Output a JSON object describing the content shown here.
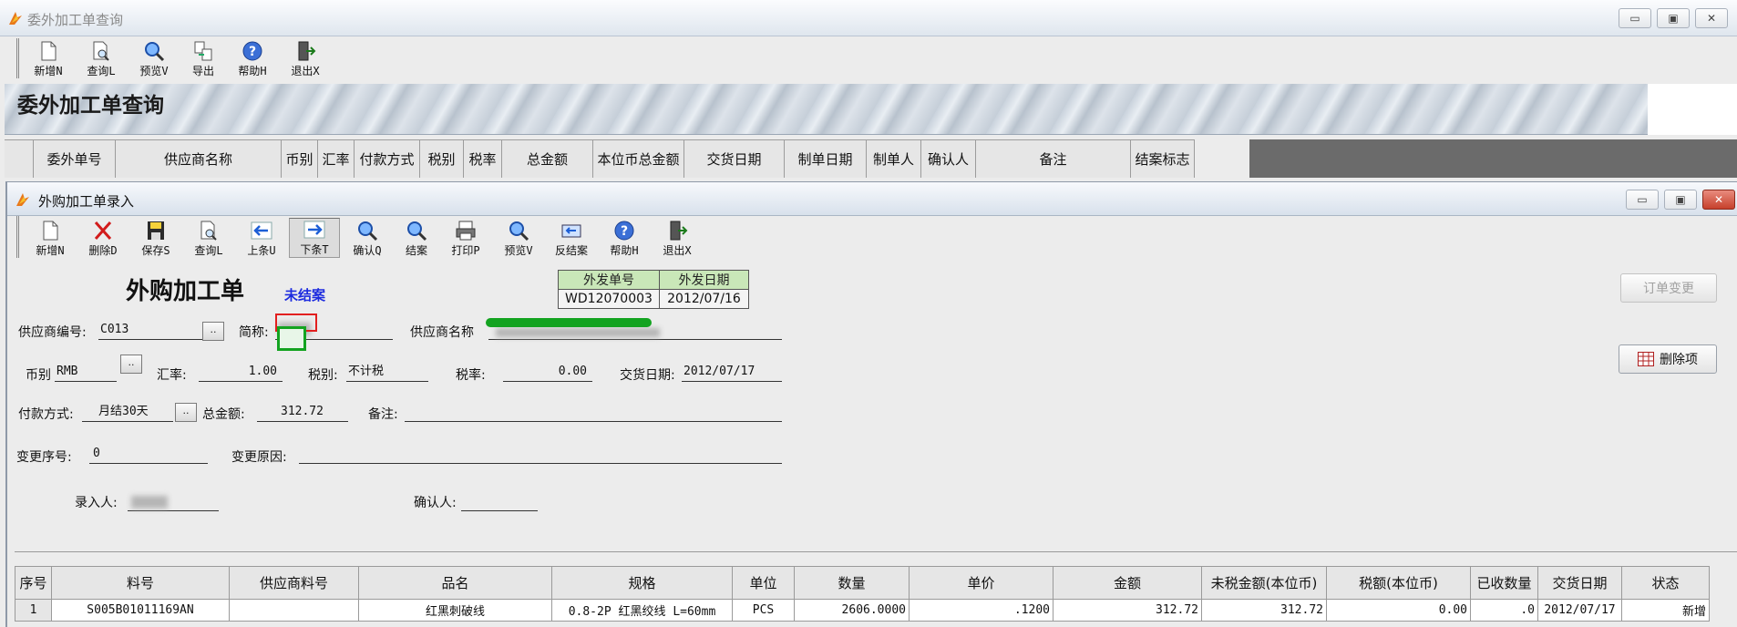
{
  "outer_window": {
    "title": "委外加工单查询",
    "buttons": {
      "minimize": "▭",
      "maximize": "▣",
      "close": "✕"
    }
  },
  "outer_toolbar": [
    {
      "label": "新增N",
      "icon": "new-doc-icon"
    },
    {
      "label": "查询L",
      "icon": "query-doc-icon"
    },
    {
      "label": "预览V",
      "icon": "preview-magnifier-icon"
    },
    {
      "label": "导出",
      "icon": "export-icon"
    },
    {
      "label": "帮助H",
      "icon": "help-icon"
    },
    {
      "label": "退出X",
      "icon": "exit-door-icon"
    }
  ],
  "banner_title": "委外加工单查询",
  "outer_grid_columns": [
    "委外单号",
    "供应商名称",
    "币别",
    "汇率",
    "付款方式",
    "税别",
    "税率",
    "总金额",
    "本位币总金额",
    "交货日期",
    "制单日期",
    "制单人",
    "确认人",
    "备注",
    "结案标志"
  ],
  "inner_window": {
    "title": "外购加工单录入",
    "buttons": {
      "minimize": "▭",
      "maximize": "▣",
      "close": "✕"
    }
  },
  "inner_toolbar": [
    {
      "label": "新增N",
      "icon": "new-doc-icon"
    },
    {
      "label": "删除D",
      "icon": "delete-x-icon"
    },
    {
      "label": "保存S",
      "icon": "save-disk-icon"
    },
    {
      "label": "查询L",
      "icon": "query-doc-icon"
    },
    {
      "label": "上条U",
      "icon": "arrow-left-icon"
    },
    {
      "label": "下条T",
      "icon": "arrow-right-icon"
    },
    {
      "label": "确认Q",
      "icon": "confirm-magnifier-icon"
    },
    {
      "label": "结案",
      "icon": "close-case-magnifier-icon"
    },
    {
      "label": "打印P",
      "icon": "printer-icon"
    },
    {
      "label": "预览V",
      "icon": "preview-magnifier-icon"
    },
    {
      "label": "反结案",
      "icon": "reverse-close-icon"
    },
    {
      "label": "帮助H",
      "icon": "help-icon"
    },
    {
      "label": "退出X",
      "icon": "exit-door-icon"
    }
  ],
  "form": {
    "title": "外购加工单",
    "status": "未结案",
    "info_headers": [
      "外发单号",
      "外发日期"
    ],
    "info_values": [
      "WD12070003",
      "2012/07/16"
    ],
    "supplier_code_label": "供应商编号:",
    "supplier_code": "C013",
    "short_name_label": "简称:",
    "supplier_name_label": "供应商名称",
    "currency_label": "币别",
    "currency": "RMB",
    "rate_label": "汇率:",
    "rate": "1.00",
    "tax_type_label": "税别:",
    "tax_type": "不计税",
    "tax_rate_label": "税率:",
    "tax_rate": "0.00",
    "delivery_label": "交货日期:",
    "delivery": "2012/07/17",
    "payment_label": "付款方式:",
    "payment": "月结30天",
    "total_label": "总金额:",
    "total": "312.72",
    "remark_label": "备注:",
    "change_no_label": "变更序号:",
    "change_no": "0",
    "change_reason_label": "变更原因:",
    "entered_by_label": "录入人:",
    "confirmed_by_label": "确认人:",
    "picker": "..",
    "btn_order_change": "订单变更",
    "btn_delete_item": "删除项"
  },
  "detail_grid": {
    "columns": [
      "序号",
      "料号",
      "供应商料号",
      "品名",
      "规格",
      "单位",
      "数量",
      "单价",
      "金额",
      "未税金额(本位币)",
      "税额(本位币)",
      "已收数量",
      "交货日期",
      "状态"
    ],
    "rows": [
      [
        "1",
        "S005B01011169AN",
        "",
        "红黑刺破线",
        "0.8-2P 红黑绞线 L=60mm",
        "PCS",
        "2606.0000",
        ".1200",
        "312.72",
        "312.72",
        "0.00",
        ".0",
        "2012/07/17",
        "新增"
      ]
    ]
  }
}
